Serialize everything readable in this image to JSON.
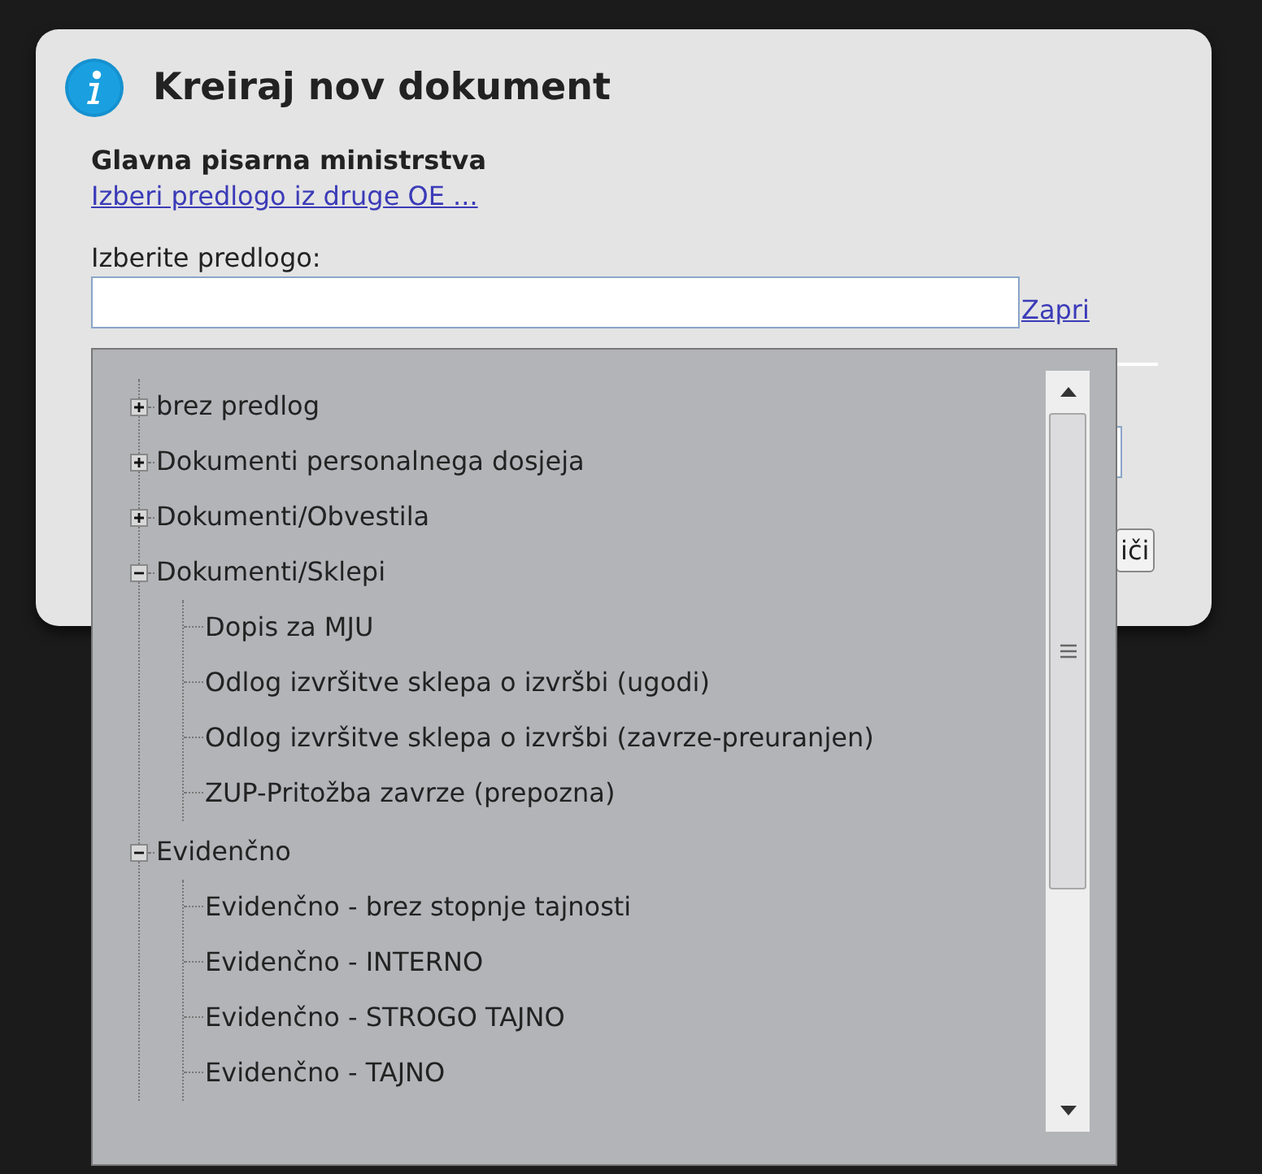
{
  "dialog": {
    "title": "Kreiraj nov dokument",
    "organization": "Glavna pisarna ministrstva",
    "other_unit_link": "Izberi predlogo iz druge OE ...",
    "template_label": "Izberite predlogo:",
    "close_link": "Zapri",
    "covered_button": "iči"
  },
  "tree": [
    {
      "label": "brez predlog",
      "expanded": false
    },
    {
      "label": "Dokumenti personalnega dosjeja",
      "expanded": false
    },
    {
      "label": "Dokumenti/Obvestila",
      "expanded": false
    },
    {
      "label": "Dokumenti/Sklepi",
      "expanded": true,
      "children": [
        {
          "label": "Dopis za MJU"
        },
        {
          "label": "Odlog izvršitve sklepa o izvršbi (ugodi)"
        },
        {
          "label": "Odlog izvršitve sklepa o izvršbi (zavrze-preuranjen)"
        },
        {
          "label": "ZUP-Pritožba zavrze (prepozna)"
        }
      ]
    },
    {
      "label": "Evidenčno",
      "expanded": true,
      "children": [
        {
          "label": "Evidenčno - brez stopnje tajnosti"
        },
        {
          "label": "Evidenčno - INTERNO"
        },
        {
          "label": "Evidenčno - STROGO TAJNO"
        },
        {
          "label": "Evidenčno - TAJNO"
        }
      ]
    }
  ]
}
